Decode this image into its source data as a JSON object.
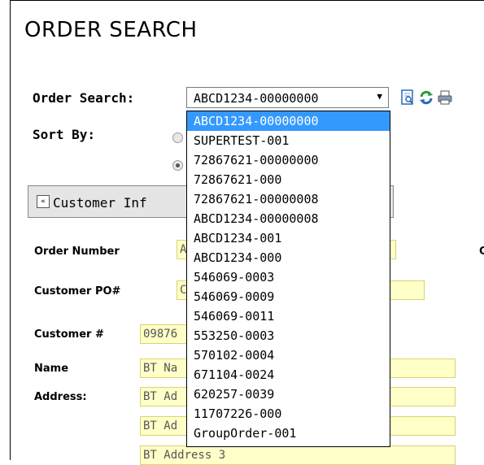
{
  "page": {
    "title": "ORDER SEARCH"
  },
  "search": {
    "label": "Order Search:",
    "selected": "ABCD1234-00000000",
    "arrow": "▼",
    "options": [
      "ABCD1234-00000000",
      "SUPERTEST-001",
      "72867621-00000000",
      "72867621-000",
      "72867621-00000008",
      "ABCD1234-00000008",
      "ABCD1234-001",
      "ABCD1234-000",
      "546069-0003",
      "546069-0009",
      "546069-0011",
      "553250-0003",
      "570102-0004",
      "671104-0024",
      "620257-0039",
      "11707226-000",
      "GroupOrder-001"
    ],
    "icons": [
      "view-document-icon",
      "refresh-icon",
      "print-icon"
    ]
  },
  "sort": {
    "label": "Sort By:"
  },
  "section": {
    "title": "Customer Inf",
    "chevron": "«"
  },
  "fields": {
    "order_number": {
      "label": "Order Number",
      "value": "A"
    },
    "customer_po": {
      "label": "Customer PO#",
      "value": "C"
    },
    "customer_num": {
      "label": "Customer #",
      "value": "09876"
    },
    "name": {
      "label": "Name",
      "value": "BT Na"
    },
    "address": {
      "label": "Address:",
      "line1": "BT Ad",
      "line2": "BT Ad",
      "line3": "BT Address 3"
    },
    "right_edge_label": "C"
  },
  "colors": {
    "selected_bg": "#3399ff",
    "input_bg": "#ffffc8"
  }
}
